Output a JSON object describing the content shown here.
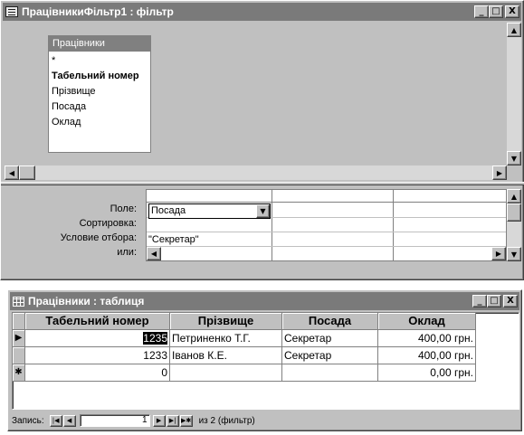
{
  "query_window": {
    "title": "ПрацівникиФільтр1 : фільтр",
    "caption_buttons": {
      "minimize": "_",
      "maximize": "□",
      "close": "X"
    },
    "field_list": {
      "title": "Працівники",
      "items": [
        "*",
        "Табельний номер",
        "Прізвище",
        "Посада",
        "Оклад"
      ]
    },
    "grid": {
      "row_labels": {
        "field": "Поле:",
        "sort": "Сортировка:",
        "criteria": "Условие отбора:",
        "or": "или:"
      },
      "field_value": "Посада",
      "criteria_value": "\"Секретар\""
    }
  },
  "table_window": {
    "title": "Працівники : таблиця",
    "caption_buttons": {
      "minimize": "_",
      "maximize": "□",
      "close": "X"
    },
    "columns": [
      "Табельний номер",
      "Прізвище",
      "Посада",
      "Оклад"
    ],
    "rows": [
      {
        "indicator": "▶",
        "number": "1235",
        "surname": "Петриненко Т.Г.",
        "position": "Секретар",
        "salary": "400,00 грн."
      },
      {
        "indicator": "",
        "number": "1233",
        "surname": "Іванов К.Е.",
        "position": "Секретар",
        "salary": "400,00 грн."
      }
    ],
    "new_row": {
      "indicator": "✱",
      "number": "0",
      "salary": "0,00 грн."
    },
    "nav": {
      "label": "Запись:",
      "current": "1",
      "total": "из 2 (фильтр)"
    }
  }
}
